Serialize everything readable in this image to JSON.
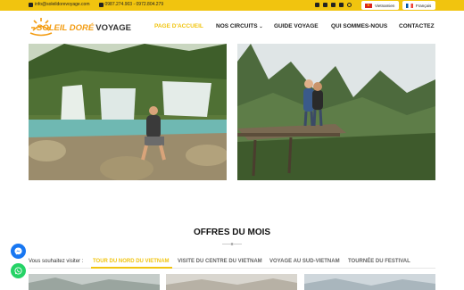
{
  "topbar": {
    "email": "info@soleildorevoyage.com",
    "phone": "0987.274.903 - 0972.804.279",
    "lang_vi": "Vietnamien",
    "lang_fr": "Français"
  },
  "logo": {
    "part1": "SOLEIL DORÉ",
    "part2": "VOYAGE"
  },
  "nav": {
    "home": "PAGE D'ACCUEIL",
    "circuits": "NOS CIRCUITS",
    "guide": "GUIDE VOYAGE",
    "about": "QUI SOMMES-NOUS",
    "contact": "CONTACTEZ"
  },
  "offers": {
    "title": "OFFRES DU MOIS",
    "prompt": "Vous souhaitez visiter :",
    "tabs": [
      "TOUR DU NORD DU VIETNAM",
      "VISITE DU CENTRE DU VIETNAM",
      "VOYAGE AU SUD-VIETNAM",
      "TOURNÉE DU FESTIVAL"
    ]
  },
  "colors": {
    "accent": "#f1c40f",
    "messenger": "#1877f2",
    "whatsapp": "#25d366"
  },
  "icons": {
    "email": "envelope-icon",
    "phone": "phone-icon",
    "social": [
      "facebook-icon",
      "instagram-icon",
      "twitter-icon",
      "email-icon"
    ],
    "search": "search-icon",
    "dropdown": "chevron-down-icon",
    "fab1": "messenger-icon",
    "fab2": "whatsapp-icon"
  }
}
